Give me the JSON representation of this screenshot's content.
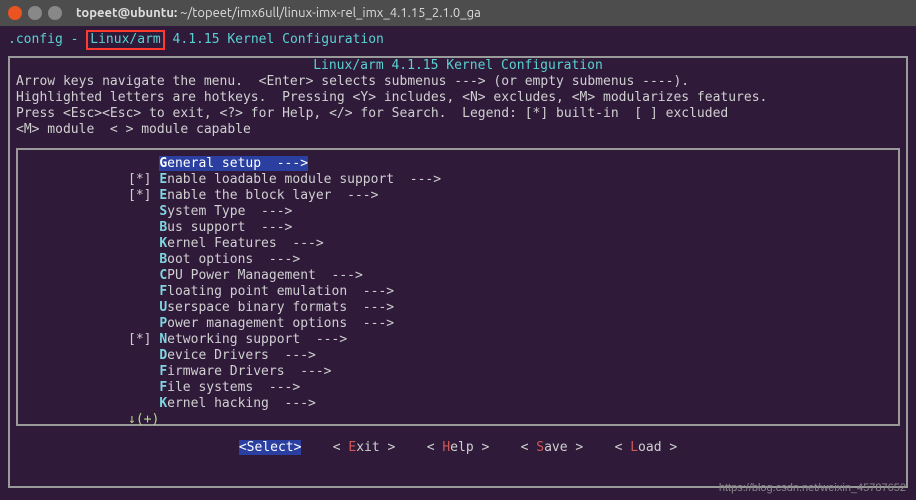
{
  "titlebar": {
    "user_host": "topeet@ubuntu:",
    "path": " ~/topeet/imx6ull/linux-imx-rel_imx_4.1.15_2.1.0_ga"
  },
  "config_line": {
    "file": ".config",
    "sep": " - ",
    "arch": "Linux/arm",
    "rest": " 4.1.15 Kernel Configuration"
  },
  "ncurses": {
    "title": "Linux/arm 4.1.15 Kernel Configuration",
    "help1": "Arrow keys navigate the menu.  <Enter> selects submenus ---> (or empty submenus ----).",
    "help2": "Highlighted letters are hotkeys.  Pressing <Y> includes, <N> excludes, <M> modularizes features.",
    "help3": "Press <Esc><Esc> to exit, <?> for Help, </> for Search.  Legend: [*] built-in  [ ] excluded",
    "help4": "<M> module  < > module capable"
  },
  "menu": {
    "items": [
      {
        "prefix": "    ",
        "hotkey": "G",
        "rest": "eneral setup  --->"
      },
      {
        "prefix": "[*] ",
        "hotkey": "E",
        "rest": "nable loadable module support  --->"
      },
      {
        "prefix": "[*] ",
        "hotkey": "E",
        "rest": "nable the block layer  --->"
      },
      {
        "prefix": "    ",
        "hotkey": "S",
        "rest": "ystem Type  --->"
      },
      {
        "prefix": "    ",
        "hotkey": "B",
        "rest": "us support  --->"
      },
      {
        "prefix": "    ",
        "hotkey": "K",
        "rest": "ernel Features  --->"
      },
      {
        "prefix": "    ",
        "hotkey": "B",
        "rest": "oot options  --->"
      },
      {
        "prefix": "    ",
        "hotkey": "C",
        "rest": "PU Power Management  --->"
      },
      {
        "prefix": "    ",
        "hotkey": "F",
        "rest": "loating point emulation  --->"
      },
      {
        "prefix": "    ",
        "hotkey": "U",
        "rest": "serspace binary formats  --->"
      },
      {
        "prefix": "    ",
        "hotkey": "P",
        "rest": "ower management options  --->"
      },
      {
        "prefix": "[*] ",
        "hotkey": "N",
        "rest": "etworking support  --->"
      },
      {
        "prefix": "    ",
        "hotkey": "D",
        "rest": "evice Drivers  --->"
      },
      {
        "prefix": "    ",
        "hotkey": "F",
        "rest": "irmware Drivers  --->"
      },
      {
        "prefix": "    ",
        "hotkey": "F",
        "rest": "ile systems  --->"
      },
      {
        "prefix": "    ",
        "hotkey": "K",
        "rest": "ernel hacking  --->"
      }
    ],
    "more_below": "↓(+)"
  },
  "buttons": {
    "select": "<Select>",
    "exit_open": "< ",
    "exit_hot": "E",
    "exit_rest": "xit >",
    "help_open": "< ",
    "help_hot": "H",
    "help_rest": "elp >",
    "save_open": "< ",
    "save_hot": "S",
    "save_rest": "ave >",
    "load_open": "< ",
    "load_hot": "L",
    "load_rest": "oad >"
  },
  "watermark": "https://blog.csdn.net/weixin_45787652"
}
